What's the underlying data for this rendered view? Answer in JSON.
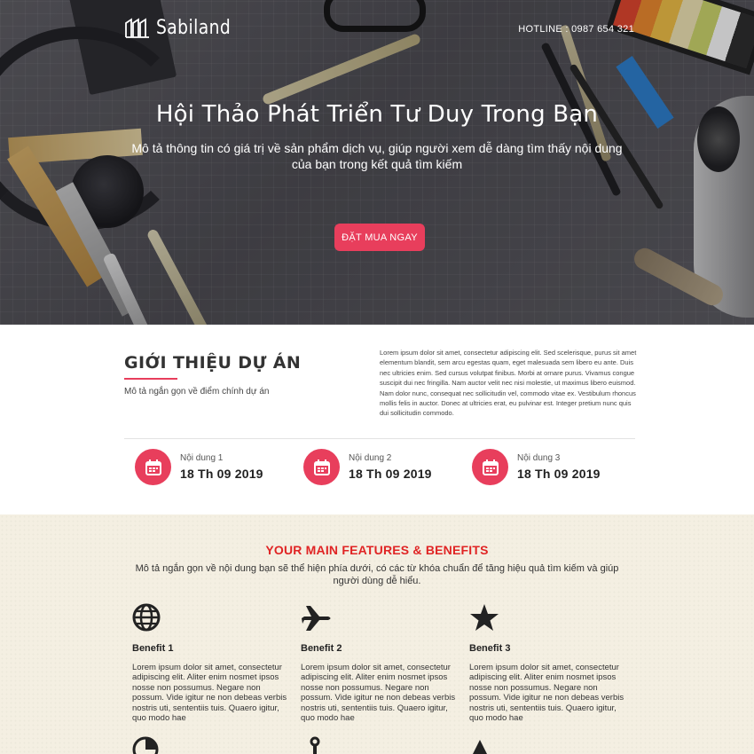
{
  "header": {
    "logo_text": "Sabiland",
    "hotline": "HOTLINE : 0987 654 321"
  },
  "hero": {
    "title": "Hội Thảo Phát Triển Tư Duy Trong Bạn",
    "description": "Mô tả thông tin có giá trị về sản phẩm dịch vụ, giúp người xem dễ dàng tìm thấy nội dung của bạn trong kết quả tìm kiếm",
    "cta_label": "ĐẶT MUA NGAY"
  },
  "intro": {
    "title": "GIỚI THIỆU DỰ ÁN",
    "subtitle": "Mô tả ngắn gọn về điểm chính dự án",
    "body": "Lorem ipsum dolor sit amet, consectetur adipiscing elit. Sed scelerisque, purus sit amet elementum blandit, sem arcu egestas quam, eget malesuada sem libero eu ante. Duis nec ultricies enim. Sed cursus volutpat finibus. Morbi at ornare purus. Vivamus congue suscipit dui nec fringilla. Nam auctor velit nec nisi molestie, ut maximus libero euismod. Nam dolor nunc, consequat nec sollicitudin vel, commodo vitae ex. Vestibulum rhoncus mollis felis in auctor. Donec at ultricies erat, eu pulvinar est. Integer pretium nunc quis dui sollicitudin commodo.",
    "stats": [
      {
        "label": "Nội dung 1",
        "value": "18 Th 09 2019",
        "icon": "calendar-icon"
      },
      {
        "label": "Nội dung 2",
        "value": "18 Th 09 2019",
        "icon": "calendar-icon"
      },
      {
        "label": "Nội dung 3",
        "value": "18 Th 09 2019",
        "icon": "calendar-icon"
      }
    ]
  },
  "features": {
    "title": "YOUR MAIN FEATURES & BENEFITS",
    "subtitle": "Mô tả ngắn gọn về nội dung bạn sẽ thể hiện phía dưới, có các từ khóa chuẩn để tăng hiệu quả tìm kiếm và giúp người dùng dễ hiểu.",
    "benefits": [
      {
        "title": "Benefit 1",
        "icon": "globe-icon",
        "desc": "Lorem ipsum dolor sit amet, consectetur adipiscing elit. Aliter enim nosmet ipsos nosse non possumus. Negare non possum. Vide igitur ne non debeas verbis nostris uti, sententiis tuis. Quaero igitur, quo modo hae"
      },
      {
        "title": "Benefit 2",
        "icon": "plane-icon",
        "desc": "Lorem ipsum dolor sit amet, consectetur adipiscing elit. Aliter enim nosmet ipsos nosse non possumus. Negare non possum. Vide igitur ne non debeas verbis nostris uti, sententiis tuis. Quaero igitur, quo modo hae"
      },
      {
        "title": "Benefit 3",
        "icon": "star-icon",
        "desc": "Lorem ipsum dolor sit amet, consectetur adipiscing elit. Aliter enim nosmet ipsos nosse non possumus. Negare non possum. Vide igitur ne non debeas verbis nostris uti, sententiis tuis. Quaero igitur, quo modo hae"
      }
    ],
    "next_row_icons": [
      "pie-chart-icon",
      "anchor-icon",
      "triangle-icon"
    ]
  },
  "colors": {
    "accent": "#e83e5c",
    "features_title": "#e02424",
    "features_bg": "#f4efe2"
  }
}
